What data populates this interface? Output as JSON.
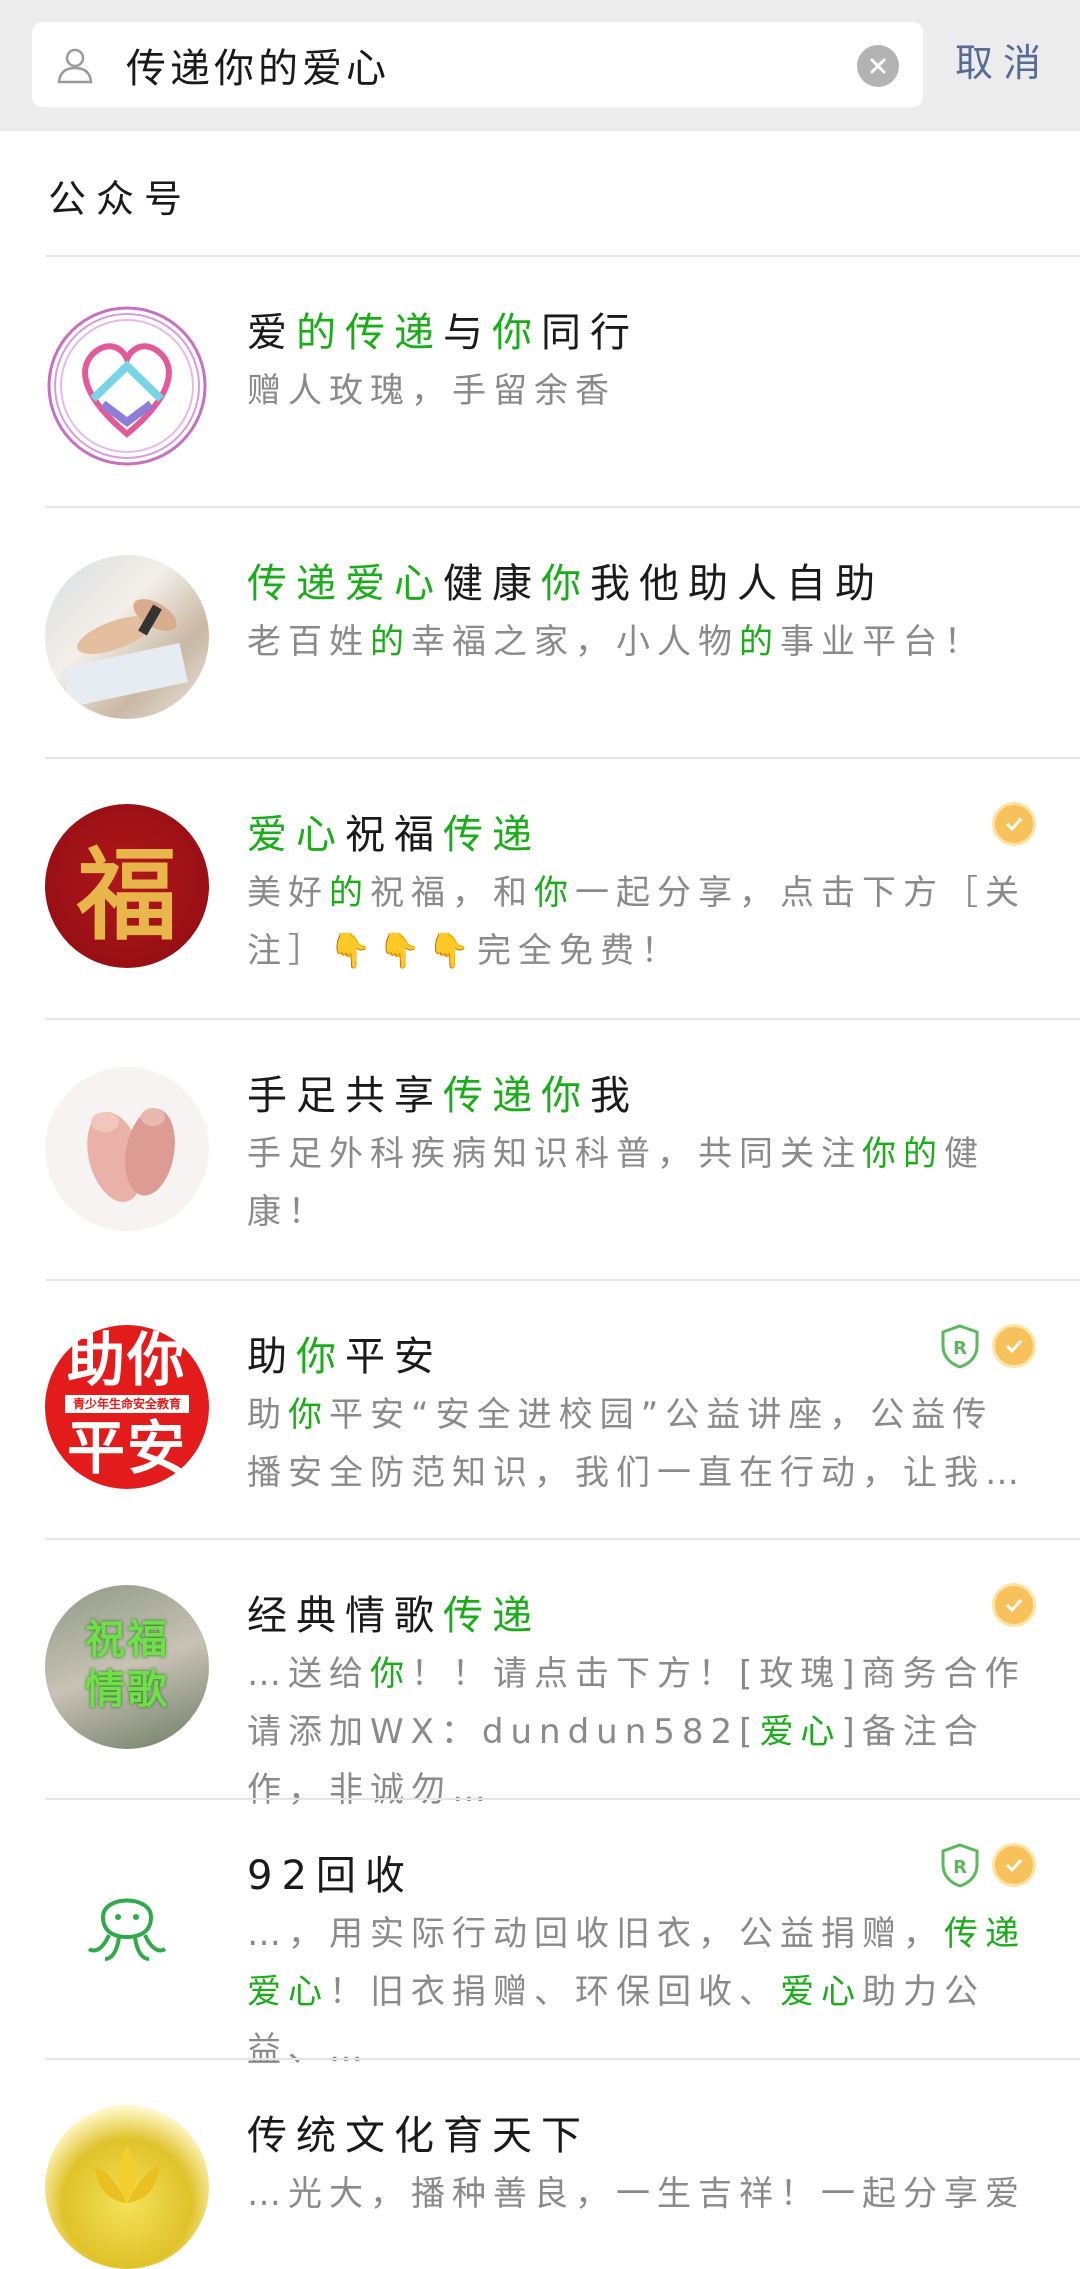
{
  "search": {
    "query": "传递你的爱心",
    "cancel_label": "取消"
  },
  "section": {
    "title": "公众号"
  },
  "colors": {
    "highlight": "#1aad19",
    "link": "#576b95",
    "verified": "#f7c25c"
  },
  "results": [
    {
      "name": [
        {
          "t": "爱"
        },
        {
          "t": "的传递",
          "h": true
        },
        {
          "t": "与"
        },
        {
          "t": "你",
          "h": true
        },
        {
          "t": "同行"
        }
      ],
      "desc": [
        {
          "t": "赠人玫瑰，手留余香"
        }
      ],
      "avatar": "heart-logo-avatar",
      "badges": []
    },
    {
      "name": [
        {
          "t": "传递爱心",
          "h": true
        },
        {
          "t": "健康"
        },
        {
          "t": "你",
          "h": true
        },
        {
          "t": "我他助人自助"
        }
      ],
      "desc": [
        {
          "t": "老百姓"
        },
        {
          "t": "的",
          "h": true
        },
        {
          "t": "幸福之家，小人物"
        },
        {
          "t": "的",
          "h": true
        },
        {
          "t": "事业平台！"
        }
      ],
      "avatar": "hands-photo-avatar",
      "badges": []
    },
    {
      "name": [
        {
          "t": "爱心",
          "h": true
        },
        {
          "t": "祝福"
        },
        {
          "t": "传递",
          "h": true
        }
      ],
      "desc": [
        {
          "t": "美好"
        },
        {
          "t": "的",
          "h": true
        },
        {
          "t": "祝福，和"
        },
        {
          "t": "你",
          "h": true
        },
        {
          "t": "一起分享，点击下方［关注］👇👇👇完全免费！"
        }
      ],
      "avatar": "fu-character-avatar",
      "avatar_text": "福",
      "badges": [
        "verified"
      ]
    },
    {
      "name": [
        {
          "t": "手足共享"
        },
        {
          "t": "传递你",
          "h": true
        },
        {
          "t": "我"
        }
      ],
      "desc": [
        {
          "t": "手足外科疾病知识科普，共同关注"
        },
        {
          "t": "你的",
          "h": true
        },
        {
          "t": "健康！"
        }
      ],
      "avatar": "baby-feet-avatar",
      "badges": []
    },
    {
      "name": [
        {
          "t": "助"
        },
        {
          "t": "你",
          "h": true
        },
        {
          "t": "平安"
        }
      ],
      "desc": [
        {
          "t": "助"
        },
        {
          "t": "你",
          "h": true
        },
        {
          "t": "平安“安全进校园”公益讲座，公益传播安全防范知识，我们一直在行动，让我…"
        }
      ],
      "avatar": "zhu-ni-ping-an-avatar",
      "avatar_text_top": "助你",
      "avatar_text_mid": "青少年生命安全教育",
      "avatar_text_bottom": "平安",
      "badges": [
        "trademark",
        "verified"
      ]
    },
    {
      "name": [
        {
          "t": "经典情歌"
        },
        {
          "t": "传递",
          "h": true
        }
      ],
      "desc": [
        {
          "t": "…送给"
        },
        {
          "t": "你",
          "h": true
        },
        {
          "t": "！！请点击下方！[玫瑰]商务合作请添加WX：dundun582["
        },
        {
          "t": "爱心",
          "h": true
        },
        {
          "t": "]备注合作，非诚勿…"
        }
      ],
      "avatar": "love-songs-avatar",
      "avatar_text_top": "祝福",
      "avatar_text_bottom": "情歌",
      "badges": [
        "verified"
      ]
    },
    {
      "name": [
        {
          "t": "92回收"
        }
      ],
      "desc": [
        {
          "t": "…，用实际行动回收旧衣，公益捐赠，"
        },
        {
          "t": "传递爱心",
          "h": true
        },
        {
          "t": "！旧衣捐赠、环保回收、"
        },
        {
          "t": "爱心",
          "h": true
        },
        {
          "t": "助力公益、…"
        }
      ],
      "avatar": "octopus-logo-avatar",
      "badges": [
        "trademark",
        "verified"
      ]
    },
    {
      "name": [
        {
          "t": "传统文化育天下"
        }
      ],
      "desc": [
        {
          "t": "…光大，播种善良，一生吉祥！一起分享爱"
        }
      ],
      "avatar": "lotus-avatar",
      "badges": []
    }
  ]
}
